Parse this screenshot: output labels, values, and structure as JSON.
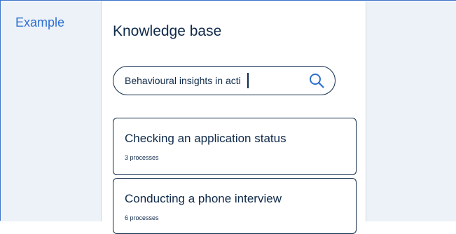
{
  "example_label": "Example",
  "knowledge_base": {
    "title": "Knowledge base",
    "search": {
      "value": "Behavioural insights in acti",
      "icon": "search-icon"
    },
    "results": [
      {
        "title": "Checking an application status",
        "subtitle": "3 processes"
      },
      {
        "title": "Conducting a phone interview",
        "subtitle": "6 processes"
      }
    ]
  },
  "colors": {
    "accent": "#2f6fd0",
    "panel_background": "#edf2f8",
    "text": "#0f2a4a"
  }
}
